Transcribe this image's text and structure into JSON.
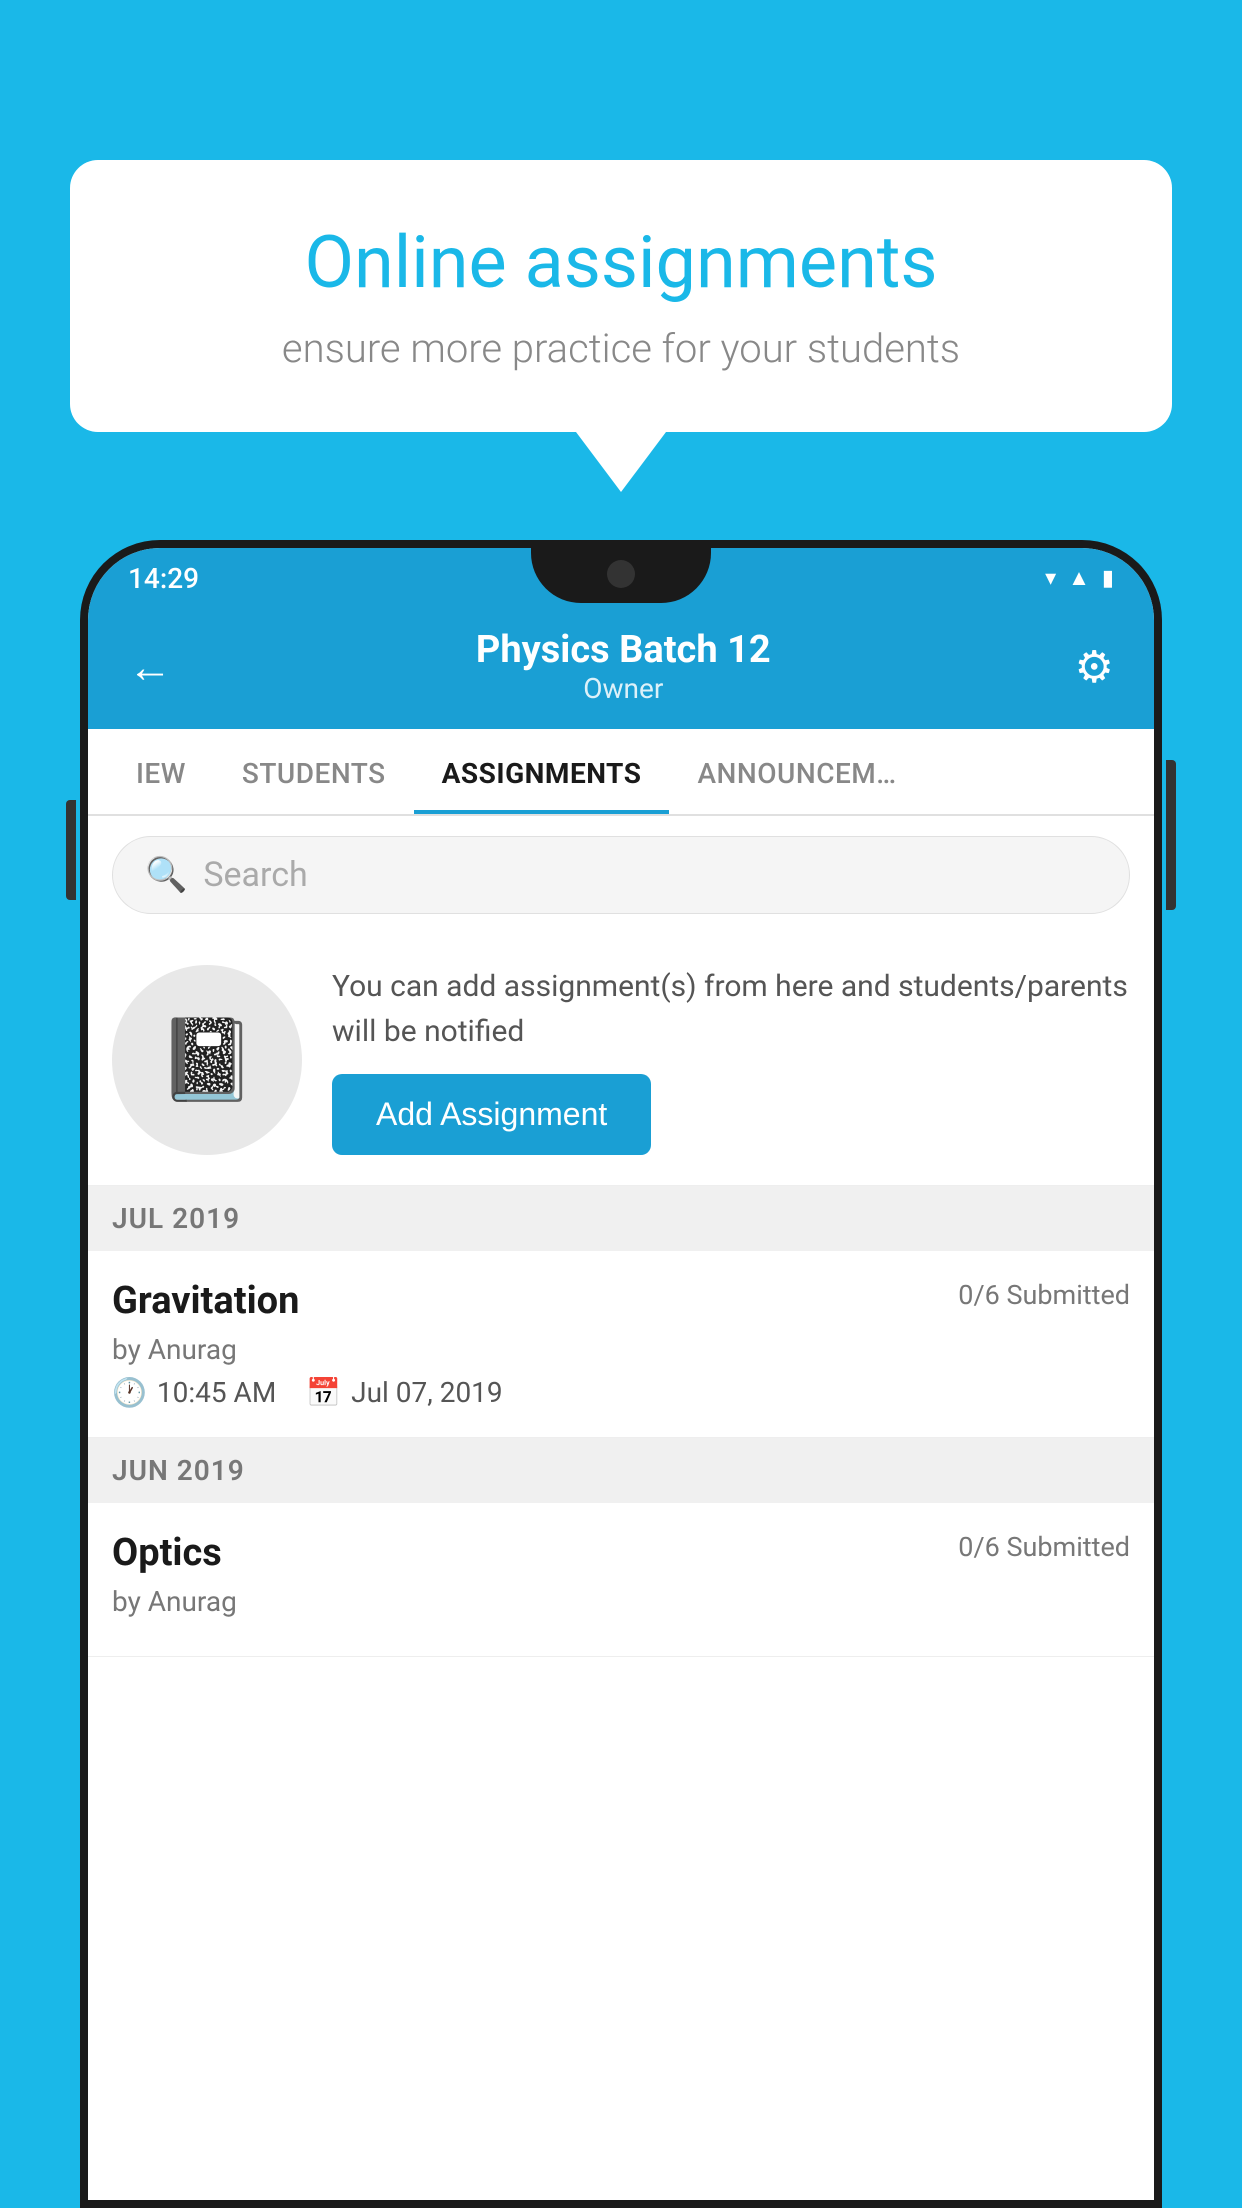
{
  "background_color": "#1ab8e8",
  "speech_bubble": {
    "title": "Online assignments",
    "subtitle": "ensure more practice for your students"
  },
  "phone": {
    "status_bar": {
      "time": "14:29",
      "icons": [
        "wifi",
        "signal",
        "battery"
      ]
    },
    "header": {
      "title": "Physics Batch 12",
      "subtitle": "Owner",
      "back_label": "←",
      "settings_label": "⚙"
    },
    "tabs": [
      {
        "label": "IEW",
        "active": false
      },
      {
        "label": "STUDENTS",
        "active": false
      },
      {
        "label": "ASSIGNMENTS",
        "active": true
      },
      {
        "label": "ANNOUNCEM…",
        "active": false
      }
    ],
    "search": {
      "placeholder": "Search"
    },
    "promo": {
      "description": "You can add assignment(s) from here and students/parents will be notified",
      "button_label": "Add Assignment"
    },
    "assignment_sections": [
      {
        "month_label": "JUL 2019",
        "assignments": [
          {
            "name": "Gravitation",
            "submitted": "0/6 Submitted",
            "author": "by Anurag",
            "time": "10:45 AM",
            "date": "Jul 07, 2019"
          }
        ]
      },
      {
        "month_label": "JUN 2019",
        "assignments": [
          {
            "name": "Optics",
            "submitted": "0/6 Submitted",
            "author": "by Anurag",
            "time": "",
            "date": ""
          }
        ]
      }
    ]
  }
}
